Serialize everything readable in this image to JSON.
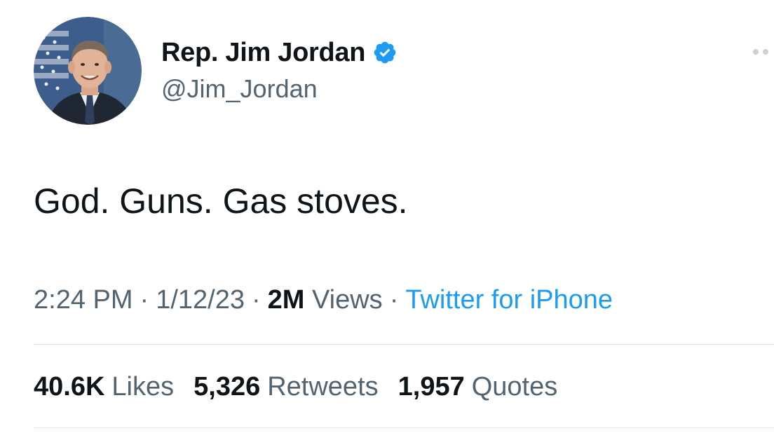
{
  "author": {
    "display_name": "Rep. Jim Jordan",
    "handle": "@Jim_Jordan",
    "verified": true,
    "verified_color": "#1d9bf0"
  },
  "tweet": {
    "text": "God. Guns. Gas stoves."
  },
  "meta": {
    "time": "2:24 PM",
    "date": "1/12/23",
    "views_count": "2M",
    "views_label": "Views",
    "source": "Twitter for iPhone",
    "separator": "·"
  },
  "stats": [
    {
      "count": "40.6K",
      "label": "Likes"
    },
    {
      "count": "5,326",
      "label": "Retweets"
    },
    {
      "count": "1,957",
      "label": "Quotes"
    }
  ],
  "icons": {
    "more": "more-dots-icon",
    "verified": "verified-badge-icon",
    "avatar": "profile-photo"
  },
  "colors": {
    "text_primary": "#0f1419",
    "text_secondary": "#536471",
    "link": "#1d9bf0",
    "divider": "#e3e7ea"
  }
}
